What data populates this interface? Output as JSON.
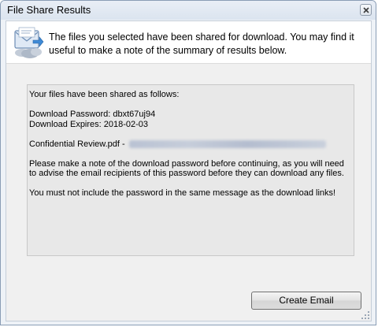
{
  "window": {
    "title": "File Share Results"
  },
  "header": {
    "icon": "email-envelope-icon",
    "message": "The files you selected have been shared for download. You may find it useful to make a note of the summary of results below."
  },
  "summary": {
    "intro": "Your files have been shared as follows:",
    "password_line": "Download Password: dbxt67uj94",
    "expires_line": "Download Expires: 2018-02-03",
    "file_line_prefix": "Confidential Review.pdf - ",
    "instruction": "Please make a note of the download password before continuing, as you will need to advise the email recipients of this password before they can download any files.",
    "warning": "You must not include the password in the same message as the download links!"
  },
  "buttons": {
    "create_email": "Create Email"
  },
  "colors": {
    "frame_border": "#8a9db5",
    "dialog_background": "#f0f0f0",
    "summary_background": "#e8e8e8"
  }
}
